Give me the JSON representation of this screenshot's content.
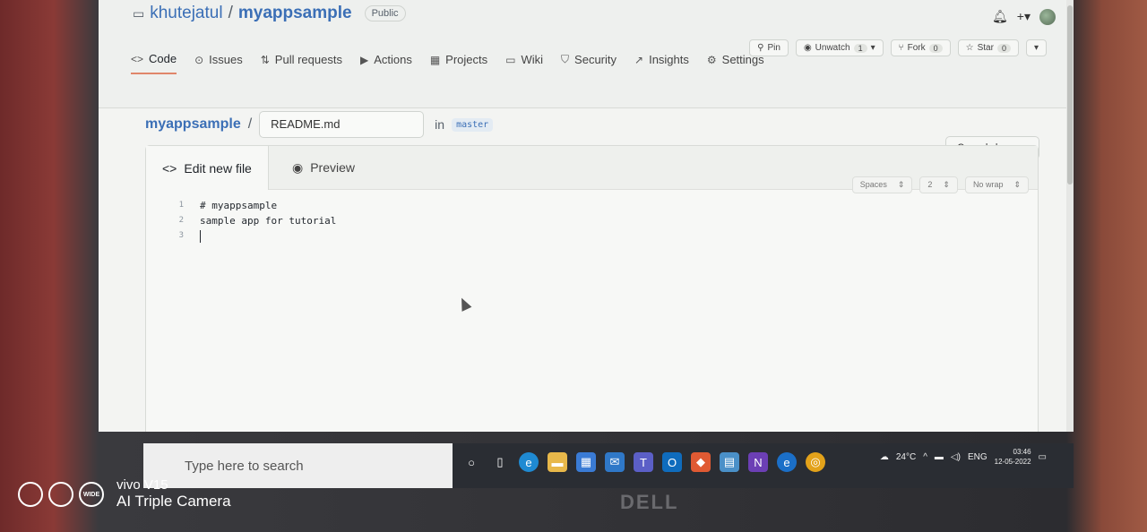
{
  "repo": {
    "owner": "khutejatul",
    "separator": "/",
    "name": "myappsample",
    "visibility": "Public"
  },
  "repo_actions": {
    "pin": "Pin",
    "unwatch": "Unwatch",
    "unwatch_count": "1",
    "fork": "Fork",
    "fork_count": "0",
    "star": "Star",
    "star_count": "0"
  },
  "tabs": [
    {
      "label": "Code",
      "icon": "<>"
    },
    {
      "label": "Issues",
      "icon": "⊙"
    },
    {
      "label": "Pull requests",
      "icon": "⇅"
    },
    {
      "label": "Actions",
      "icon": "▶"
    },
    {
      "label": "Projects",
      "icon": "▦"
    },
    {
      "label": "Wiki",
      "icon": "▭"
    },
    {
      "label": "Security",
      "icon": "⛉"
    },
    {
      "label": "Insights",
      "icon": "↗"
    },
    {
      "label": "Settings",
      "icon": "⚙"
    }
  ],
  "breadcrumb": {
    "repo": "myappsample",
    "slash": "/",
    "filename": "README.md",
    "in": "in",
    "branch": "master"
  },
  "cancel_label": "Cancel changes",
  "editor_tabs": {
    "edit": "Edit new file",
    "preview": "Preview"
  },
  "editor_options": {
    "indent_mode": "Spaces",
    "indent_size": "2",
    "wrap_mode": "No wrap"
  },
  "code_lines": [
    {
      "num": "1",
      "text": "# myappsample"
    },
    {
      "num": "2",
      "text": "sample app for tutorial"
    },
    {
      "num": "3",
      "text": ""
    }
  ],
  "taskbar": {
    "search_placeholder": "Type here to search",
    "temperature": "24°C",
    "language": "ENG",
    "time": "03:46",
    "date": "12-05-2022"
  },
  "watermark": {
    "line1": "vivo V15",
    "line2": "AI Triple Camera",
    "wide": "WIDE"
  },
  "laptop_brand": "DELL"
}
